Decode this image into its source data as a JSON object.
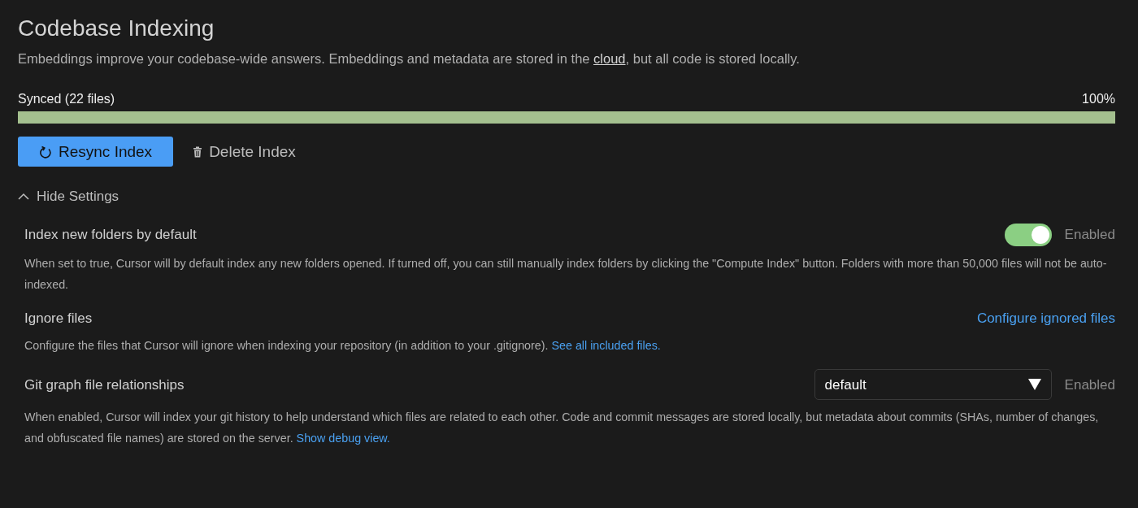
{
  "title": "Codebase Indexing",
  "intro": {
    "text": "Embeddings improve your codebase-wide answers. Embeddings and metadata are stored in the",
    "link": "cloud",
    "text_after": ", but all code is stored locally."
  },
  "progress": {
    "label": "Synced (22 files)",
    "reading": "100%",
    "level": 1.0
  },
  "actions": [
    {
      "kind": "primary",
      "label": "Resync Index"
    },
    {
      "kind": "delete",
      "label": "Delete Index"
    }
  ],
  "settings_toggle": {
    "label": "Hide Settings",
    "expanded": true
  },
  "settings": [
    {
      "kind": "toggle",
      "label": "Index new folders by default",
      "on": true,
      "status": "Enabled",
      "description": "When set to true, Cursor will by default index any new folders opened. If turned off, you can still manually index folders by clicking the \"Compute Index\" button. Folders with more than 50,000 files will not be auto-indexed."
    },
    {
      "kind": "link",
      "label": "Ignore files",
      "action": "Configure ignored files",
      "description": "Configure the files that Cursor will ignore when indexing your repository (in addition to your .gitignore).",
      "link": "See all included files."
    },
    {
      "kind": "select",
      "label": "Git graph file relationships",
      "value": "default",
      "status": "Enabled",
      "description": "When enabled, Cursor will index your git history to help understand which files are related to each other. Code and commit messages are stored locally, but metadata about commits (SHAs, number of changes, and obfuscated file names) are stored on the server.",
      "link": "Show debug view."
    }
  ]
}
